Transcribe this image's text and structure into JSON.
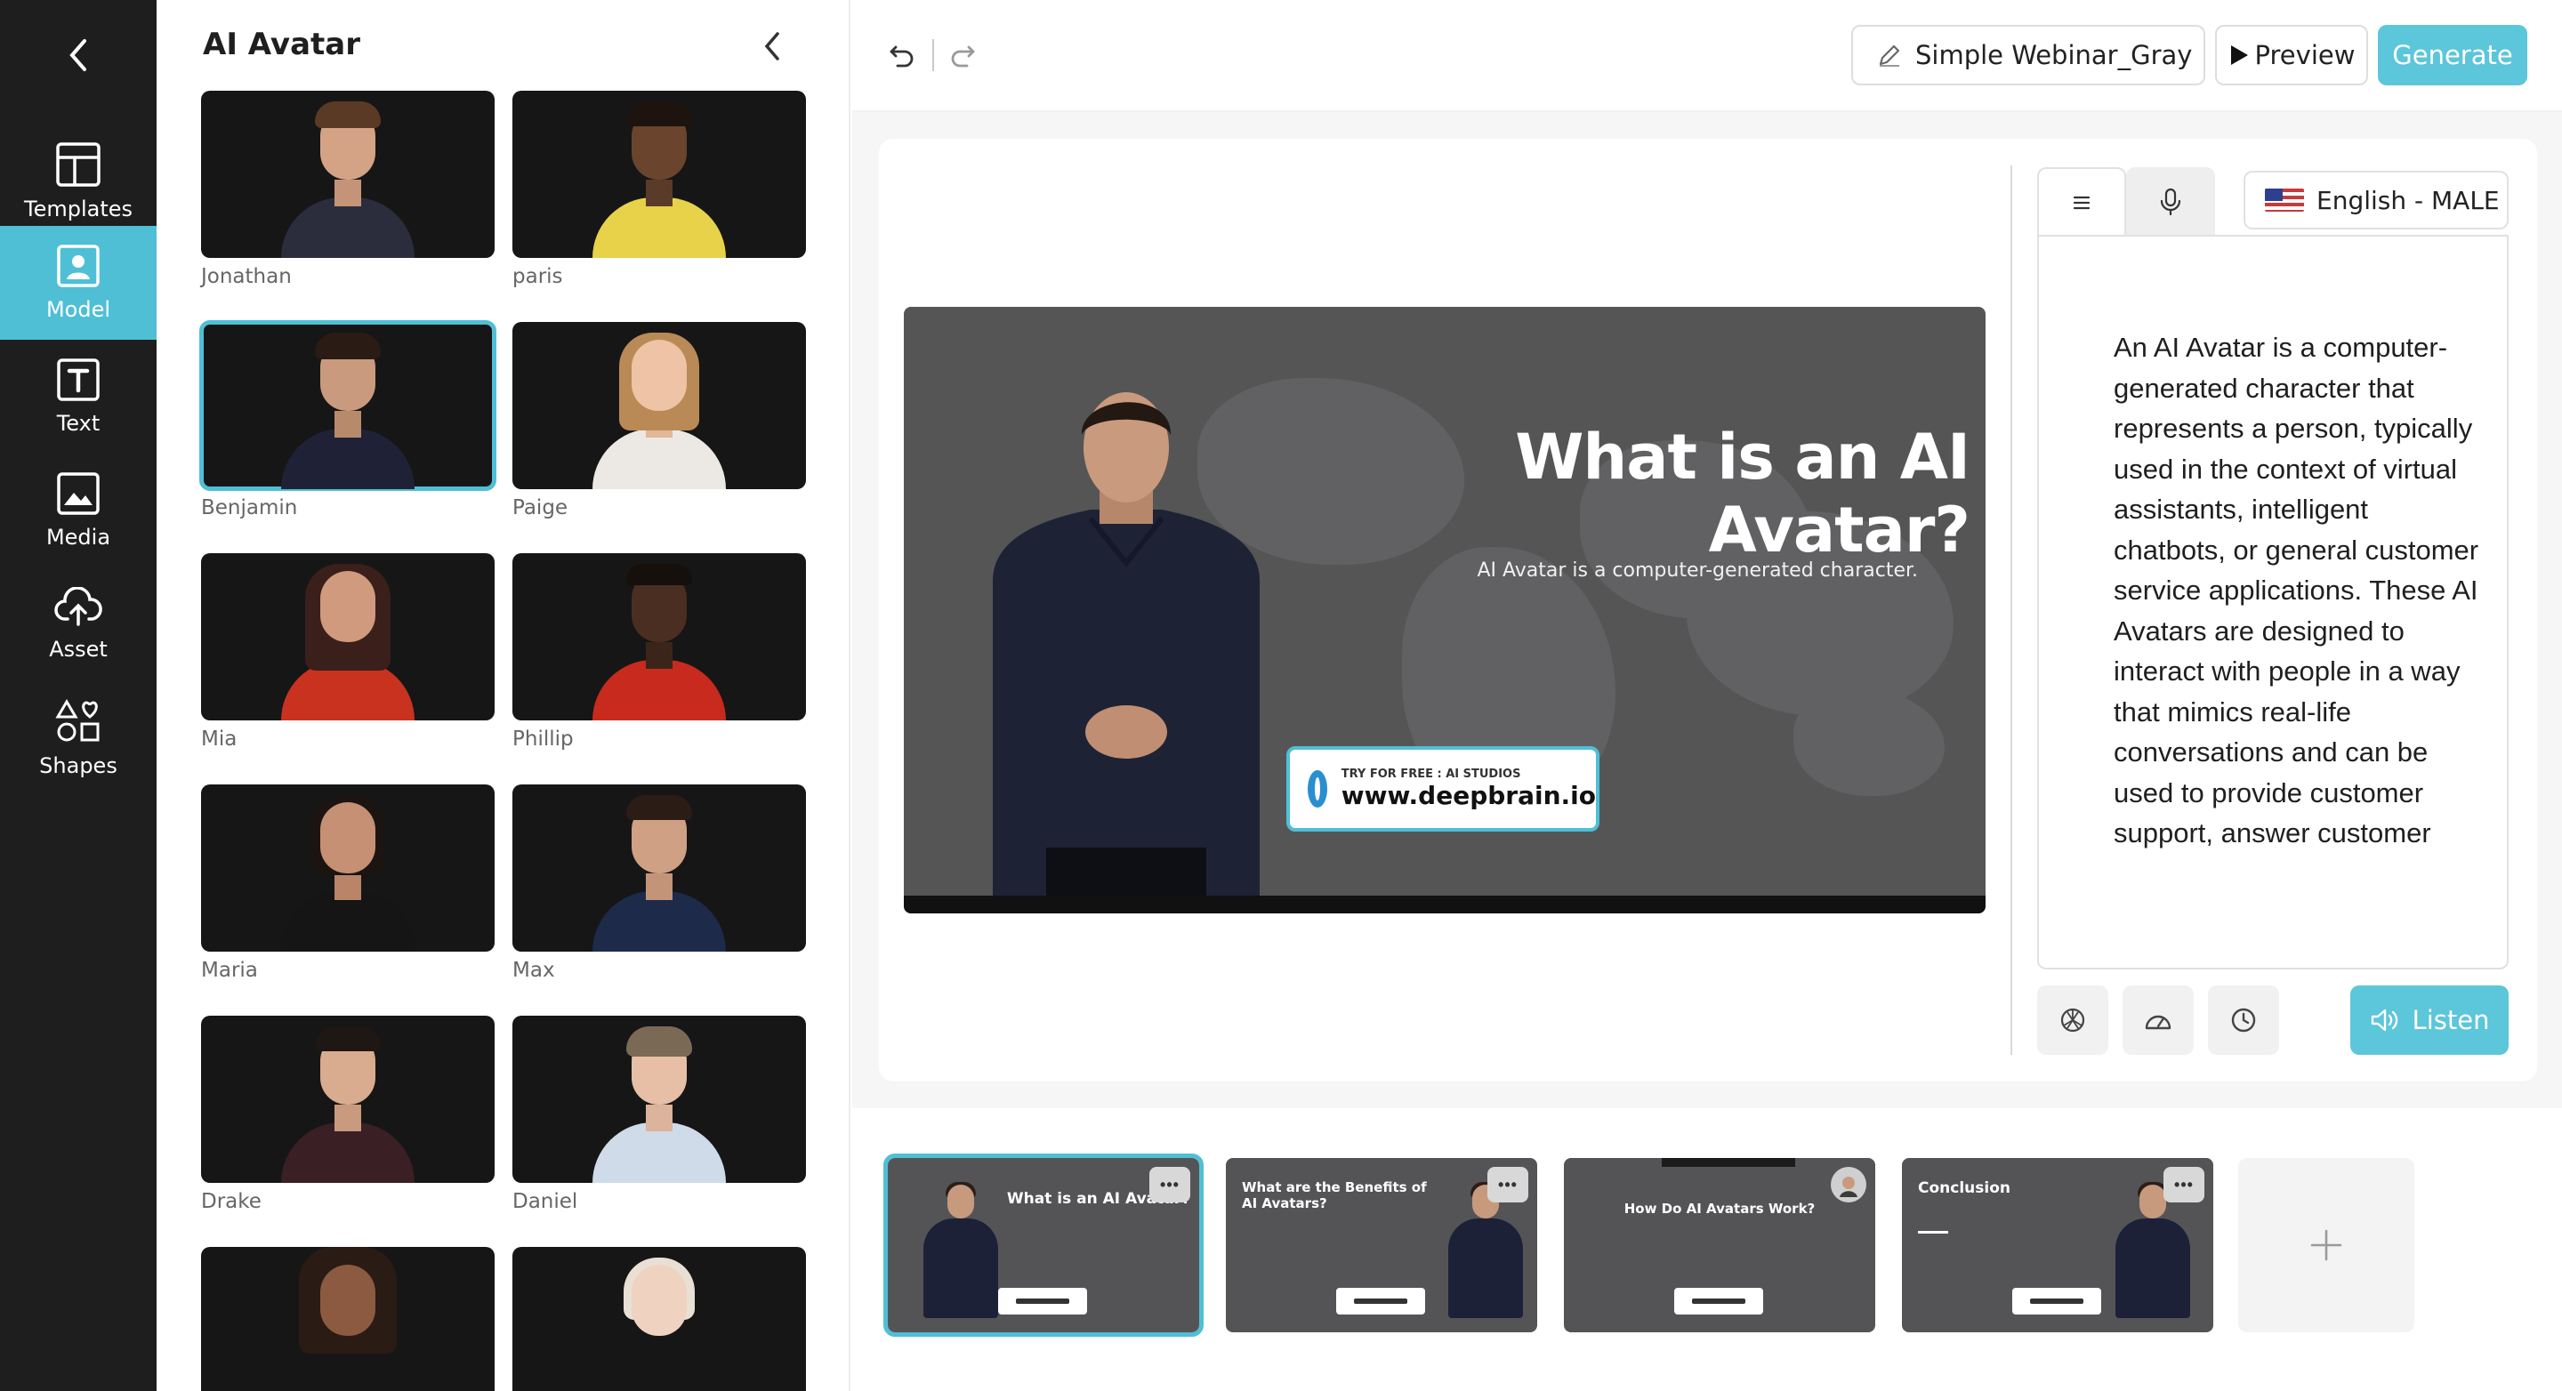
{
  "rail": {
    "items": [
      {
        "label": "Templates",
        "icon": "layout-icon"
      },
      {
        "label": "Model",
        "icon": "person-icon",
        "active": true
      },
      {
        "label": "Text",
        "icon": "text-icon"
      },
      {
        "label": "Media",
        "icon": "image-icon"
      },
      {
        "label": "Asset",
        "icon": "upload-cloud-icon"
      },
      {
        "label": "Shapes",
        "icon": "shapes-icon"
      }
    ]
  },
  "panel": {
    "title": "AI Avatar",
    "models": [
      {
        "name": "Jonathan"
      },
      {
        "name": "paris"
      },
      {
        "name": "Benjamin",
        "selected": true
      },
      {
        "name": "Paige"
      },
      {
        "name": "Mia"
      },
      {
        "name": "Phillip"
      },
      {
        "name": "Maria"
      },
      {
        "name": "Max"
      },
      {
        "name": "Drake"
      },
      {
        "name": "Daniel"
      }
    ]
  },
  "toolbar": {
    "template_name": "Simple Webinar_Gray",
    "preview_label": "Preview",
    "generate_label": "Generate"
  },
  "slide": {
    "title": "What is an AI Avatar?",
    "subtitle": "AI Avatar is a computer-generated character.",
    "badge_small": "TRY FOR FREE : AI STUDIOS",
    "badge_url": "www.deepbrain.io"
  },
  "script": {
    "language": "English - MALE",
    "text": "An AI Avatar is a computer-generated character that represents a person, typically used in the context of virtual assistants, intelligent chatbots, or general customer service applications. These AI Avatars are designed to interact with people in a way that mimics real-life conversations and can be used to provide customer support, answer customer",
    "listen_label": "Listen"
  },
  "scenes": [
    {
      "title": "What is an AI Avatar?",
      "active": true
    },
    {
      "title": "What are the Benefits of AI Avatars?"
    },
    {
      "title": "How Do AI Avatars Work?"
    },
    {
      "title": "Conclusion"
    }
  ],
  "colors": {
    "accent": "#5cc6da",
    "rail_bg": "#1e1e1e",
    "slide_bg": "#555556"
  }
}
